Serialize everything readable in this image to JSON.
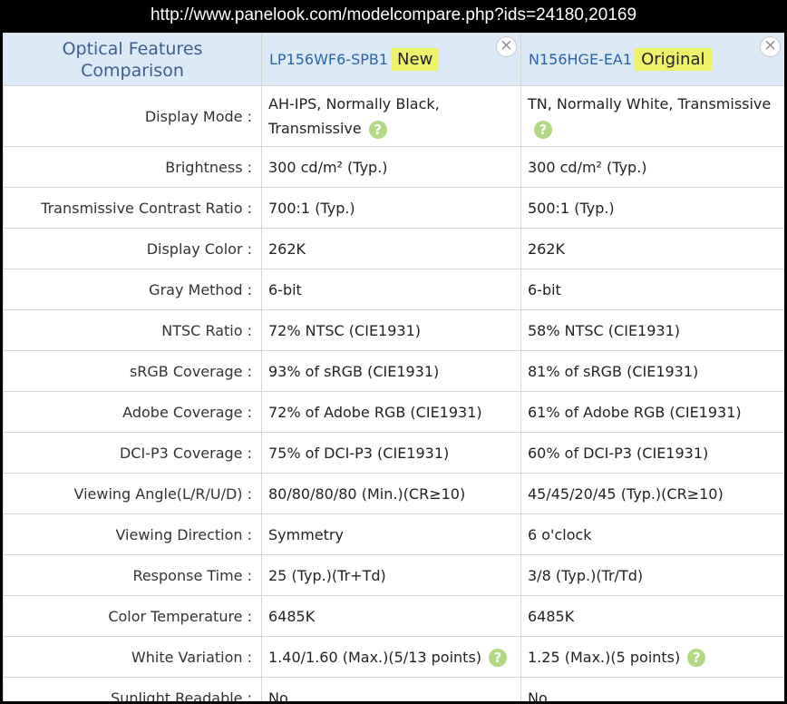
{
  "url": "http://www.panelook.com/modelcompare.php?ids=24180,20169",
  "header": {
    "title_line1": "Optical Features",
    "title_line2": "Comparison",
    "models": [
      {
        "name": "LP156WF6-SPB1",
        "badge": "New",
        "close": "×"
      },
      {
        "name": "N156HGE-EA1",
        "badge": "Original",
        "close": "×"
      }
    ]
  },
  "help_glyph": "?",
  "rows": [
    {
      "label": "Display Mode :",
      "v1a": "AH-IPS, Normally Black,",
      "v1b": "Transmissive",
      "v2": "TN, Normally White, Transmissive"
    },
    {
      "label": "Brightness :",
      "v1": "300 cd/m² (Typ.)",
      "v2": "300 cd/m² (Typ.)"
    },
    {
      "label": "Transmissive Contrast Ratio :",
      "v1": "700:1 (Typ.)",
      "v2": "500:1 (Typ.)"
    },
    {
      "label": "Display Color :",
      "v1": "262K",
      "v2": "262K"
    },
    {
      "label": "Gray Method :",
      "v1": "6-bit",
      "v2": "6-bit"
    },
    {
      "label": "NTSC Ratio :",
      "v1": "72% NTSC (CIE1931)",
      "v2": "58% NTSC (CIE1931)"
    },
    {
      "label": "sRGB Coverage :",
      "v1": "93% of sRGB (CIE1931)",
      "v2": "81% of sRGB (CIE1931)"
    },
    {
      "label": "Adobe Coverage :",
      "v1": "72% of Adobe RGB (CIE1931)",
      "v2": "61% of Adobe RGB (CIE1931)"
    },
    {
      "label": "DCI-P3 Coverage :",
      "v1": "75% of DCI-P3 (CIE1931)",
      "v2": "60% of DCI-P3 (CIE1931)"
    },
    {
      "label": "Viewing Angle(L/R/U/D) :",
      "v1": "80/80/80/80 (Min.)(CR≥10)",
      "v2": "45/45/20/45 (Typ.)(CR≥10)"
    },
    {
      "label": "Viewing Direction :",
      "v1": "Symmetry",
      "v2": "6 o'clock"
    },
    {
      "label": "Response Time :",
      "v1": "25 (Typ.)(Tr+Td)",
      "v2": "3/8 (Typ.)(Tr/Td)"
    },
    {
      "label": "Color Temperature :",
      "v1": "6485K",
      "v2": "6485K"
    },
    {
      "label": "White Variation :",
      "v1": "1.40/1.60 (Max.)(5/13 points)",
      "v2": "1.25 (Max.)(5 points)"
    },
    {
      "label": "Sunlight Readable :",
      "v1": "No",
      "v2": "No"
    }
  ],
  "colors": {
    "header_bg": "#dce9f6",
    "model_link": "#2a64ad",
    "badge_bg": "#eef36a",
    "help_icon": "#b3d982"
  }
}
